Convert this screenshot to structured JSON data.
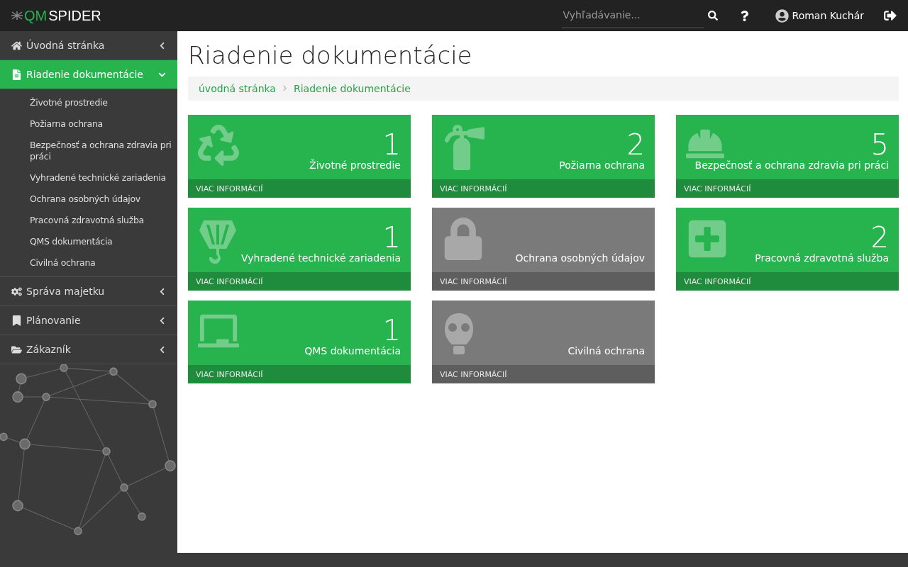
{
  "logo": {
    "accent": "QM",
    "rest": "SPIDER"
  },
  "topbar": {
    "search": {
      "placeholder": "Vyhľadávanie..."
    },
    "user": "Roman Kuchár"
  },
  "sidebar": {
    "items": [
      {
        "label": "Úvodná stránka",
        "kind": "home",
        "selected": false,
        "expanded": false
      },
      {
        "label": "Riadenie dokumentácie",
        "kind": "file",
        "selected": true,
        "expanded": true,
        "children": [
          {
            "label": "Životné prostredie"
          },
          {
            "label": "Požiarna ochrana"
          },
          {
            "label": "Bezpečnosť a ochrana zdravia pri práci"
          },
          {
            "label": "Vyhradené technické zariadenia"
          },
          {
            "label": "Ochrana osobných údajov"
          },
          {
            "label": "Pracovná zdravotná služba"
          },
          {
            "label": "QMS dokumentácia"
          },
          {
            "label": "Civilná ochrana"
          }
        ]
      },
      {
        "label": "Správa majetku",
        "kind": "gears",
        "selected": false,
        "expanded": false
      },
      {
        "label": "Plánovanie",
        "kind": "bookmark",
        "selected": false,
        "expanded": false
      },
      {
        "label": "Zákazník",
        "kind": "folder",
        "selected": false,
        "expanded": false
      }
    ]
  },
  "page": {
    "title": "Riadenie dokumentácie",
    "breadcrumb": [
      "úvodná stránka",
      "Riadenie dokumentácie"
    ]
  },
  "tiles": [
    {
      "kind": "recycle",
      "count": "1",
      "label": "Životné prostredie",
      "active": true,
      "footer": "VIAC INFORMÁCIÍ"
    },
    {
      "kind": "extinguisher",
      "count": "2",
      "label": "Požiarna ochrana",
      "active": true,
      "footer": "VIAC INFORMÁCIÍ"
    },
    {
      "kind": "helmet",
      "count": "5",
      "label": "Bezpečnosť a ochrana zdravia pri práci",
      "active": true,
      "footer": "VIAC INFORMÁCIÍ"
    },
    {
      "kind": "hook",
      "count": "1",
      "label": "Vyhradené technické zariadenia",
      "active": true,
      "footer": "VIAC INFORMÁCIÍ"
    },
    {
      "kind": "lock",
      "label": "Ochrana osobných údajov",
      "active": false,
      "footer": "VIAC INFORMÁCIÍ"
    },
    {
      "kind": "medical",
      "count": "2",
      "label": "Pracovná zdravotná služba",
      "active": true,
      "footer": "VIAC INFORMÁCIÍ"
    },
    {
      "kind": "presentation",
      "count": "1",
      "label": "QMS dokumentácia",
      "active": true,
      "footer": "VIAC INFORMÁCIÍ"
    },
    {
      "kind": "gasmask",
      "label": "Civilná ochrana",
      "active": false,
      "footer": "VIAC INFORMÁCIÍ"
    }
  ]
}
